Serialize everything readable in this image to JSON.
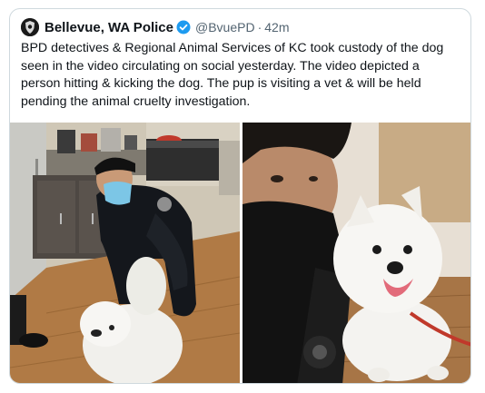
{
  "tweet": {
    "display_name": "Bellevue, WA Police",
    "handle": "@BvuePD",
    "separator": "·",
    "time": "42m",
    "text_lines": [
      "BPD detectives & Regional Animal Services of KC took custody of the dog",
      "seen in the video circulating on social yesterday. The video depicted a",
      "person hitting & kicking the dog. The pup is visiting a vet & will be held",
      "pending the animal cruelty investigation."
    ]
  },
  "icons": {
    "avatar": "police-badge-icon",
    "verified": "verified-badge-icon"
  },
  "colors": {
    "verified_blue": "#1d9bf0",
    "muted_text": "#536471",
    "border": "#cfd9de"
  }
}
